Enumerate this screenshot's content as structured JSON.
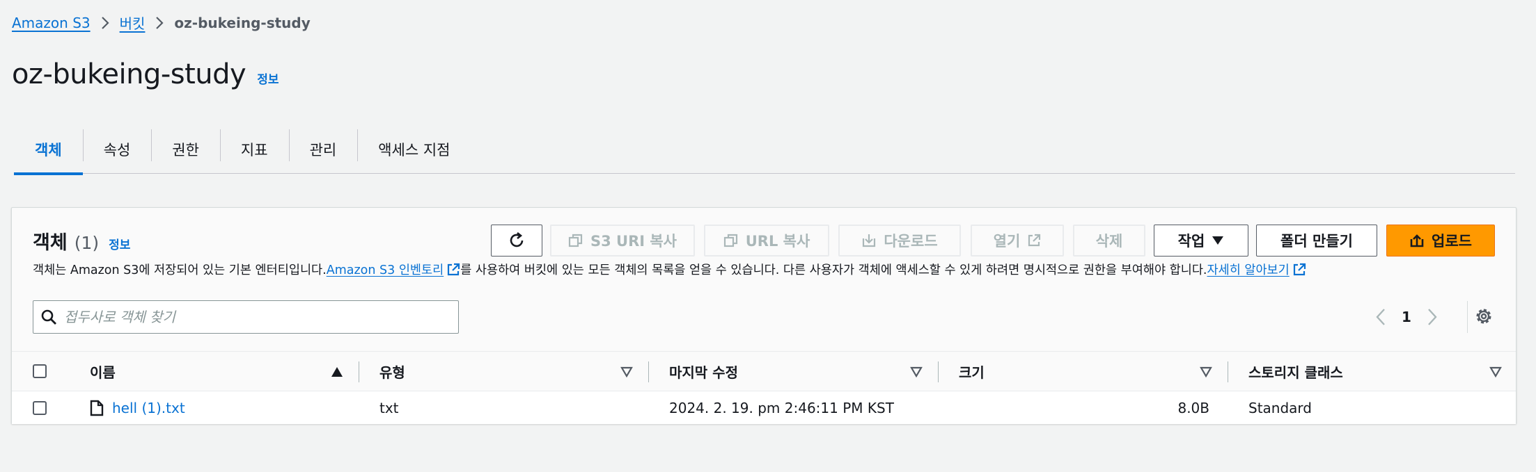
{
  "breadcrumb": {
    "items": [
      "Amazon S3",
      "버킷"
    ],
    "current": "oz-bukeing-study"
  },
  "header": {
    "title": "oz-bukeing-study",
    "info": "정보"
  },
  "tabs": [
    "객체",
    "속성",
    "권한",
    "지표",
    "관리",
    "액세스 지점"
  ],
  "objects_panel": {
    "title": "객체",
    "count": "(1)",
    "info": "정보",
    "description": {
      "part1": "객체는 Amazon S3에 저장되어 있는 기본 엔터티입니다. ",
      "inventory_link": "Amazon S3 인벤토리",
      "part2": "를 사용하여 버킷에 있는 모든 객체의 목록을 얻을 수 있습니다. 다른 사용자가 객체에 액세스할 수 있게 하려면 명시적으로 권한을 부여해야 합니다. ",
      "learn_more_link": "자세히 알아보기"
    },
    "toolbar": {
      "copy_s3_uri": "S3 URI 복사",
      "copy_url": "URL 복사",
      "download": "다운로드",
      "open": "열기",
      "delete": "삭제",
      "actions": "작업",
      "create_folder": "폴더 만들기",
      "upload": "업로드"
    },
    "search": {
      "placeholder": "접두사로 객체 찾기",
      "value": ""
    },
    "pagination": {
      "page": "1"
    },
    "table": {
      "columns": [
        "이름",
        "유형",
        "마지막 수정",
        "크기",
        "스토리지 클래스"
      ],
      "rows": [
        {
          "name": "hell (1).txt",
          "type": "txt",
          "last_modified": "2024. 2. 19. pm 2:46:11 PM KST",
          "size": "8.0B",
          "storage_class": "Standard"
        }
      ]
    }
  },
  "colors": {
    "link": "#0972d3",
    "primary_button": "#ff9900",
    "page_background": "#f2f3f3",
    "disabled_text": "#aab7b8"
  }
}
